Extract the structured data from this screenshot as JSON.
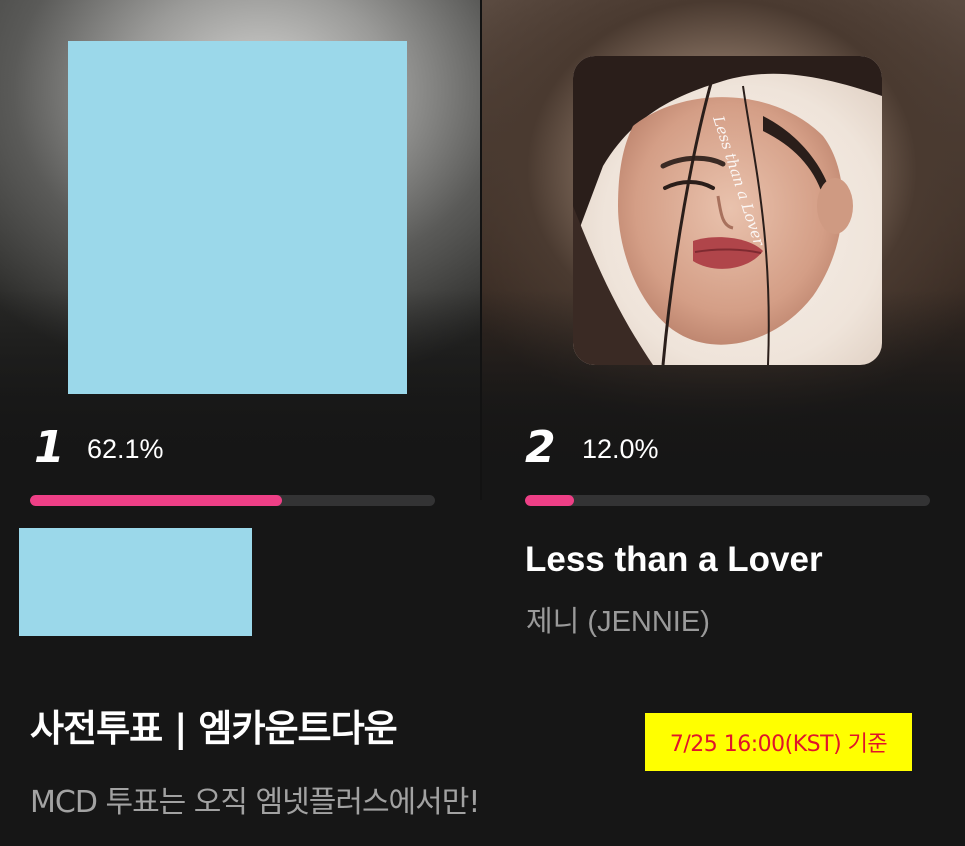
{
  "ranking": [
    {
      "rank": "1",
      "percent": "62.1%",
      "vote_share": 0.621,
      "title": "",
      "artist": ""
    },
    {
      "rank": "2",
      "percent": "12.0%",
      "vote_share": 0.12,
      "title": "Less than a Lover",
      "artist": "제니 (JENNIE)",
      "album_art_text": "Less than a Lover"
    }
  ],
  "vote_section": {
    "headline": "사전투표 | 엠카운트다운",
    "subline": "MCD 투표는 오직 엠넷플러스에서만!",
    "timestamp": "7/25 16:00(KST) 기준"
  },
  "colors": {
    "background": "#161616",
    "progress_fill": "#ee3f86",
    "progress_track": "#333334",
    "redaction": "#9bd8ea",
    "timestamp_bg": "#ffff00",
    "timestamp_text": "#e0142a"
  }
}
